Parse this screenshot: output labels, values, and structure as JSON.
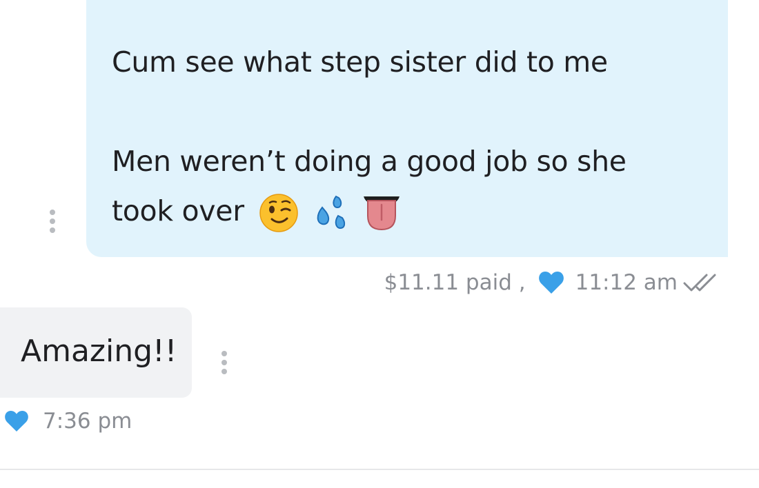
{
  "sent_message": {
    "line1": "Cum see what step sister did to me",
    "line2": "Men weren’t doing a good job so she",
    "line3": "took over",
    "emojis": [
      "winking-face",
      "sweat-droplets",
      "tongue"
    ],
    "price": "$11.11 paid ,",
    "liked": true,
    "time": "11:12 am",
    "status": "read"
  },
  "received_message": {
    "text": "Amazing!!",
    "liked": true,
    "time": "7:36 pm"
  },
  "colors": {
    "sent_bubble": "#e1f3fc",
    "received_bubble": "#f1f2f4",
    "heart": "#3aa0e8",
    "meta_text": "#8a8d93"
  }
}
